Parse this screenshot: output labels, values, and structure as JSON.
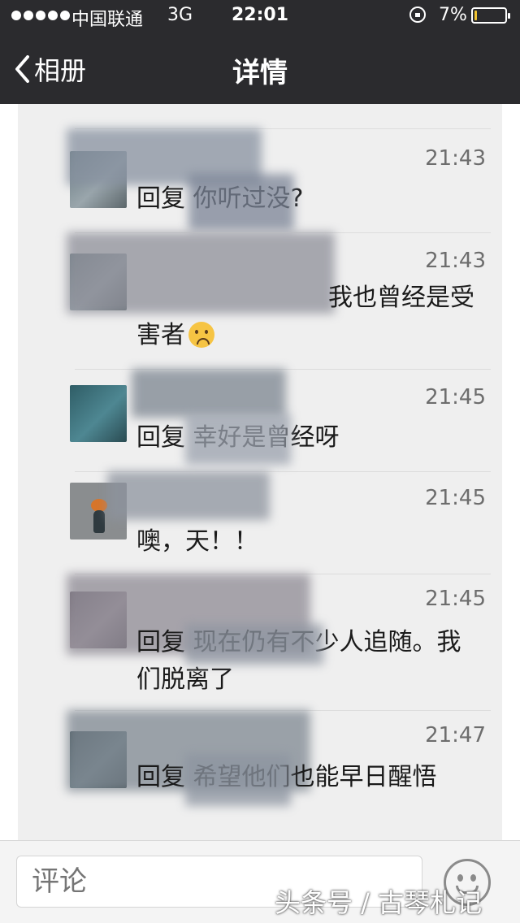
{
  "status_bar": {
    "carrier": "中国联通",
    "network": "3G",
    "time": "22:01",
    "battery": "7%",
    "battery_level": 0.07,
    "battery_color": "#f0c330"
  },
  "nav": {
    "back_label": "相册",
    "title": "详情"
  },
  "comments": [
    {
      "time": "21:43",
      "text": "回复 你听过没?"
    },
    {
      "time": "21:43",
      "text": "我也曾经是受害者"
    },
    {
      "time": "21:45",
      "text": "回复 幸好是曾经呀"
    },
    {
      "time": "21:45",
      "text": "噢，天！！"
    },
    {
      "time": "21:45",
      "text": "回复 现在仍有不少人追随。我们脱离了"
    },
    {
      "time": "21:47",
      "text": "回复 希望他们也能早日醒悟"
    }
  ],
  "comment_bar": {
    "placeholder": "评论",
    "emoji_icon": "smiley-face-icon"
  },
  "watermark": "头条号 / 古琴札记",
  "colors": {
    "top_bar": "#2b2b2e",
    "list_bg": "#efefef"
  }
}
